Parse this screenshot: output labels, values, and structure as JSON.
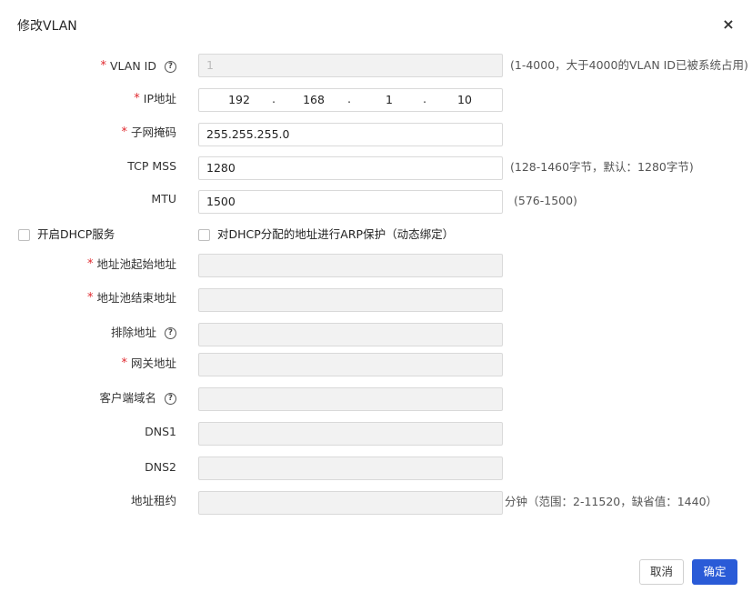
{
  "dialog": {
    "title": "修改VLAN",
    "close_label": "×"
  },
  "fields": {
    "vlan_id": {
      "label": "VLAN ID",
      "required": true,
      "value": "1",
      "hint": "(1-4000，大于4000的VLAN ID已被系统占用)"
    },
    "ip": {
      "label": "IP地址",
      "required": true,
      "segments": [
        "192",
        "168",
        "1",
        "10"
      ],
      "dot": "."
    },
    "mask": {
      "label": "子网掩码",
      "required": true,
      "value": "255.255.255.0"
    },
    "tcp_mss": {
      "label": "TCP MSS",
      "value": "1280",
      "hint": "(128-1460字节，默认：1280字节)"
    },
    "mtu": {
      "label": "MTU",
      "value": "1500",
      "hint": "(576-1500)"
    },
    "pool_start": {
      "label": "地址池起始地址",
      "required": true,
      "value": ""
    },
    "pool_end": {
      "label": "地址池结束地址",
      "required": true,
      "value": ""
    },
    "exclude": {
      "label": "排除地址",
      "value": ""
    },
    "gateway": {
      "label": "网关地址",
      "required": true,
      "value": ""
    },
    "client_domain": {
      "label": "客户端域名",
      "value": ""
    },
    "dns1": {
      "label": "DNS1",
      "value": ""
    },
    "dns2": {
      "label": "DNS2",
      "value": ""
    },
    "lease": {
      "label": "地址租约",
      "value": "",
      "hint": "分钟（范围：2-11520，缺省值：1440）"
    }
  },
  "checkboxes": {
    "dhcp": {
      "label": "开启DHCP服务",
      "checked": false
    },
    "arp": {
      "label": "对DHCP分配的地址进行ARP保护（动态绑定）",
      "checked": false
    }
  },
  "buttons": {
    "cancel": "取消",
    "ok": "确定"
  },
  "symbols": {
    "required_mark": "*",
    "help": "?"
  },
  "colors": {
    "primary": "#2a5bd7",
    "required": "#e0282e",
    "disabled_bg": "#f2f2f2"
  }
}
